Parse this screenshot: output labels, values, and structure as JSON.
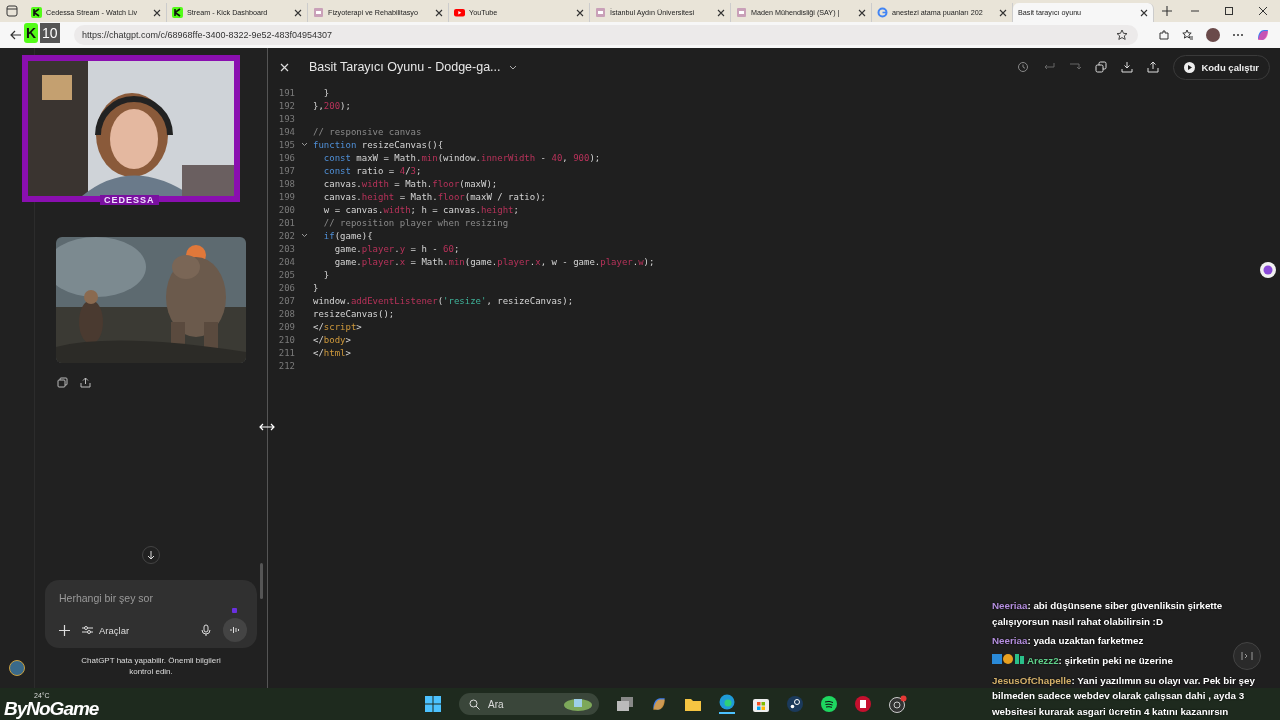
{
  "browser": {
    "tabs": [
      {
        "label": "Cedessa Stream - Watch Liv",
        "selected": false
      },
      {
        "label": "Stream - Kick Dashboard",
        "selected": false
      },
      {
        "label": "Fizyoterapi ve Rehabilitasyo",
        "selected": false
      },
      {
        "label": "YouTube",
        "selected": false
      },
      {
        "label": "İstanbul Aydın Üniversitesi",
        "selected": false
      },
      {
        "label": "Maden Mühendisliği (SAY) |",
        "selected": false
      },
      {
        "label": "anestezi atama puanları 202",
        "selected": false
      },
      {
        "label": "Basit tarayıcı oyunu",
        "selected": true
      }
    ],
    "url": "https://chatgpt.com/c/68968ffe-3400-8322-9e52-483f04954307"
  },
  "chat": {
    "placeholder": "Herhangi bir şey sor",
    "tools_label": "Araçlar",
    "disclaimer": "ChatGPT hata yapabilir. Önemli bilgileri kontrol edin."
  },
  "canvas": {
    "title": "Basit Tarayıcı Oyunu - Dodge-ga...",
    "run_label": "Kodu çalıştır",
    "lines": [
      {
        "num": "191",
        "fold": false,
        "tokens": [
          {
            "kind": "plain",
            "text": "  }"
          }
        ]
      },
      {
        "num": "192",
        "fold": false,
        "tokens": [
          {
            "kind": "plain",
            "text": "},"
          },
          {
            "kind": "num",
            "text": "200"
          },
          {
            "kind": "plain",
            "text": ");"
          }
        ]
      },
      {
        "num": "193",
        "fold": false
      },
      {
        "num": "194",
        "fold": false,
        "tokens": [
          {
            "kind": "comment",
            "text": "// responsive canvas"
          }
        ]
      },
      {
        "num": "195",
        "fold": true,
        "tokens": [
          {
            "kind": "keyword",
            "text": "function"
          },
          {
            "kind": "plain",
            "text": " resizeCanvas(){"
          }
        ]
      },
      {
        "num": "196",
        "fold": false,
        "tokens": [
          {
            "kind": "keyword",
            "text": "  const"
          },
          {
            "kind": "plain",
            "text": " maxW = Math."
          },
          {
            "kind": "prop",
            "text": "min"
          },
          {
            "kind": "plain",
            "text": "(window."
          },
          {
            "kind": "prop",
            "text": "innerWidth"
          },
          {
            "kind": "plain",
            "text": " - "
          },
          {
            "kind": "num",
            "text": "40"
          },
          {
            "kind": "plain",
            "text": ", "
          },
          {
            "kind": "num",
            "text": "900"
          },
          {
            "kind": "plain",
            "text": ");"
          }
        ]
      },
      {
        "num": "197",
        "fold": false,
        "tokens": [
          {
            "kind": "keyword",
            "text": "  const"
          },
          {
            "kind": "plain",
            "text": " ratio = "
          },
          {
            "kind": "num",
            "text": "4"
          },
          {
            "kind": "plain",
            "text": "/"
          },
          {
            "kind": "num",
            "text": "3"
          },
          {
            "kind": "plain",
            "text": ";"
          }
        ]
      },
      {
        "num": "198",
        "fold": false,
        "tokens": [
          {
            "kind": "plain",
            "text": "  canvas."
          },
          {
            "kind": "prop",
            "text": "width"
          },
          {
            "kind": "plain",
            "text": " = Math."
          },
          {
            "kind": "prop",
            "text": "floor"
          },
          {
            "kind": "plain",
            "text": "(maxW);"
          }
        ]
      },
      {
        "num": "199",
        "fold": false,
        "tokens": [
          {
            "kind": "plain",
            "text": "  canvas."
          },
          {
            "kind": "prop",
            "text": "height"
          },
          {
            "kind": "plain",
            "text": " = Math."
          },
          {
            "kind": "prop",
            "text": "floor"
          },
          {
            "kind": "plain",
            "text": "(maxW / ratio);"
          }
        ]
      },
      {
        "num": "200",
        "fold": false,
        "tokens": [
          {
            "kind": "plain",
            "text": "  w = canvas."
          },
          {
            "kind": "prop",
            "text": "width"
          },
          {
            "kind": "plain",
            "text": "; h = canvas."
          },
          {
            "kind": "prop",
            "text": "height"
          },
          {
            "kind": "plain",
            "text": ";"
          }
        ]
      },
      {
        "num": "201",
        "fold": false,
        "tokens": [
          {
            "kind": "comment",
            "text": "  // reposition player when resizing"
          }
        ]
      },
      {
        "num": "202",
        "fold": true,
        "tokens": [
          {
            "kind": "keyword",
            "text": "  if"
          },
          {
            "kind": "plain",
            "text": "(game){"
          }
        ]
      },
      {
        "num": "203",
        "fold": false,
        "tokens": [
          {
            "kind": "plain",
            "text": "    game."
          },
          {
            "kind": "prop",
            "text": "player"
          },
          {
            "kind": "plain",
            "text": "."
          },
          {
            "kind": "prop",
            "text": "y"
          },
          {
            "kind": "plain",
            "text": " = h - "
          },
          {
            "kind": "num",
            "text": "60"
          },
          {
            "kind": "plain",
            "text": ";"
          }
        ]
      },
      {
        "num": "204",
        "fold": false,
        "tokens": [
          {
            "kind": "plain",
            "text": "    game."
          },
          {
            "kind": "prop",
            "text": "player"
          },
          {
            "kind": "plain",
            "text": "."
          },
          {
            "kind": "prop",
            "text": "x"
          },
          {
            "kind": "plain",
            "text": " = Math."
          },
          {
            "kind": "prop",
            "text": "min"
          },
          {
            "kind": "plain",
            "text": "(game."
          },
          {
            "kind": "prop",
            "text": "player"
          },
          {
            "kind": "plain",
            "text": "."
          },
          {
            "kind": "prop",
            "text": "x"
          },
          {
            "kind": "plain",
            "text": ", w - game."
          },
          {
            "kind": "prop",
            "text": "player"
          },
          {
            "kind": "plain",
            "text": "."
          },
          {
            "kind": "prop",
            "text": "w"
          },
          {
            "kind": "plain",
            "text": ");"
          }
        ]
      },
      {
        "num": "205",
        "fold": false,
        "tokens": [
          {
            "kind": "plain",
            "text": "  }"
          }
        ]
      },
      {
        "num": "206",
        "fold": false,
        "tokens": [
          {
            "kind": "plain",
            "text": "}"
          }
        ]
      },
      {
        "num": "207",
        "fold": false,
        "tokens": [
          {
            "kind": "plain",
            "text": "window."
          },
          {
            "kind": "prop",
            "text": "addEventListener"
          },
          {
            "kind": "plain",
            "text": "("
          },
          {
            "kind": "string",
            "text": "'resize'"
          },
          {
            "kind": "plain",
            "text": ", resizeCanvas);"
          }
        ]
      },
      {
        "num": "208",
        "fold": false,
        "tokens": [
          {
            "kind": "plain",
            "text": "resizeCanvas();"
          }
        ]
      },
      {
        "num": "209",
        "fold": false,
        "tokens": [
          {
            "kind": "plain",
            "text": "</"
          },
          {
            "kind": "tag",
            "text": "script"
          },
          {
            "kind": "plain",
            "text": ">"
          }
        ]
      },
      {
        "num": "210",
        "fold": false,
        "tokens": [
          {
            "kind": "plain",
            "text": "</"
          },
          {
            "kind": "tag",
            "text": "body"
          },
          {
            "kind": "plain",
            "text": ">"
          }
        ]
      },
      {
        "num": "211",
        "fold": false,
        "tokens": [
          {
            "kind": "plain",
            "text": "</"
          },
          {
            "kind": "tag",
            "text": "html"
          },
          {
            "kind": "plain",
            "text": ">"
          }
        ]
      },
      {
        "num": "212",
        "fold": false
      }
    ]
  },
  "stream": {
    "kick_logo": "K",
    "viewers": "10",
    "cam_label": "CEDESSA",
    "brand": "ByNoGame",
    "weather": "24°C",
    "messages": [
      {
        "user": "Neeriaa",
        "color": "#b48ede",
        "kind": "plain",
        "text": ": abi düşünsene siber güvenliksin şirkette çalışıyorsun nasıl rahat olabilirsin :D"
      },
      {
        "user": "Neeriaa",
        "color": "#b48ede",
        "kind": "plain",
        "text": ": yada uzaktan farketmez"
      },
      {
        "user": "Arezz2",
        "color": "#5fcf8a",
        "kind": "badged",
        "text": ": şirketin peki ne üzerine"
      },
      {
        "user": "JesusOfChapelle",
        "color": "#d4b06a",
        "kind": "plain",
        "text": ": Yani yazılımın su olayı var. Pek bir şey bilmeden sadece webdev olarak çalışsan dahi , ayda 3 websitesi kurarak asgari ücretin 4 katını kazanırsın"
      }
    ]
  },
  "taskbar": {
    "search_placeholder": "Ara"
  }
}
